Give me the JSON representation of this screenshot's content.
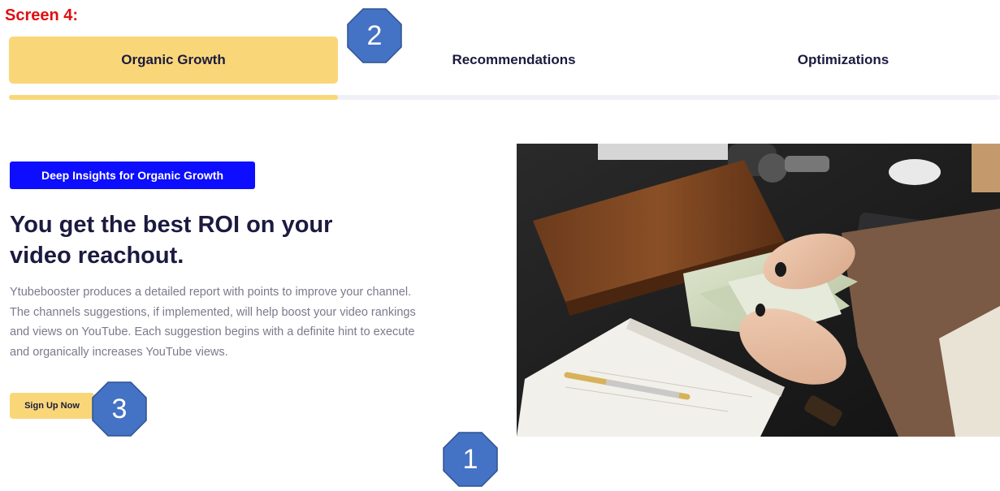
{
  "screen_label": "Screen 4:",
  "tabs": [
    {
      "label": "Organic Growth",
      "active": true
    },
    {
      "label": "Recommendations",
      "active": false
    },
    {
      "label": "Optimizations",
      "active": false
    }
  ],
  "hero": {
    "badge": "Deep Insights for Organic Growth",
    "headline": "You get the best ROI on your video reachout.",
    "description": "Ytubebooster produces a detailed report with points to improve your channel. The channels suggestions, if implemented, will help boost your video rankings and views on YouTube. Each suggestion begins with a definite hint to execute and organically increases YouTube views.",
    "cta_label": "Sign Up Now",
    "image_icon": "photo-hands-counting-money"
  },
  "annotations": [
    {
      "number": "1"
    },
    {
      "number": "2"
    },
    {
      "number": "3"
    }
  ],
  "colors": {
    "accent_yellow": "#f9d779",
    "badge_blue": "#0d0dff",
    "heading_navy": "#1c1a3f",
    "body_gray": "#7b7a8c",
    "screen_label_red": "#e01010",
    "marker_blue": "#4472c4"
  }
}
